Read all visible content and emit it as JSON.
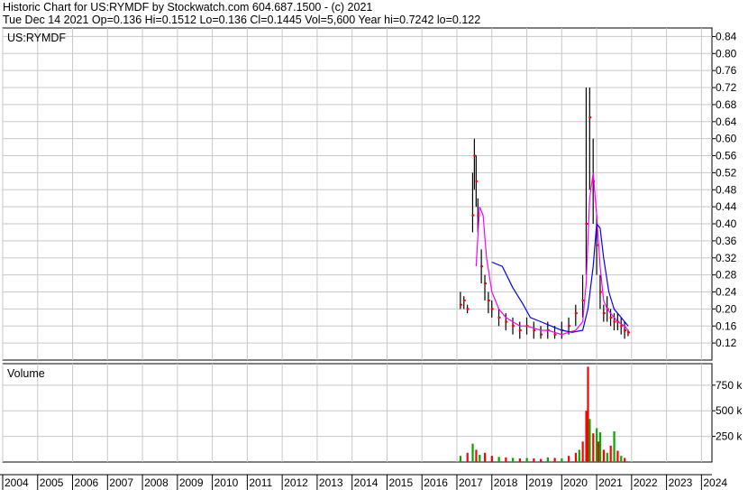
{
  "header": {
    "line1": "Historic Chart for US:RYMDF by Stockwatch.com 604.687.1500 - (c) 2021",
    "line2": "Tue Dec 14 2021   Op=0.136   Hi=0.1512   Lo=0.136   Cl=0.1445   Vol=5,600   Year hi=0.7242   lo=0.122"
  },
  "colors": {
    "price": "#000000",
    "close_marker": "#ff0000",
    "ma_short": "#ff00ff",
    "ma_long": "#0000ff",
    "volume_up": "#00aa00",
    "volume_down": "#ff0000",
    "grid": "#c8c8c8"
  },
  "chart_data": [
    {
      "type": "line",
      "title": "US:RYMDF",
      "xlabel": "",
      "ylabel": "",
      "ylim": [
        0.08,
        0.86
      ],
      "x_range": [
        2004,
        2024.3
      ],
      "grid": true,
      "y_ticks": [
        0.12,
        0.16,
        0.2,
        0.24,
        0.28,
        0.32,
        0.36,
        0.4,
        0.44,
        0.48,
        0.52,
        0.56,
        0.6,
        0.64,
        0.68,
        0.72,
        0.76,
        0.8,
        0.84
      ],
      "y_tick_labels": [
        "0.12",
        "0.16",
        "0.20",
        "0.24",
        "0.28",
        "0.32",
        "0.36",
        "0.40",
        "0.44",
        "0.48",
        "0.52",
        "0.56",
        "0.60",
        "0.64",
        "0.68",
        "0.72",
        "0.76",
        "0.80",
        "0.84"
      ],
      "series": [
        {
          "key": "price",
          "x": [
            2017.1,
            2017.2,
            2017.3,
            2017.45,
            2017.5,
            2017.55,
            2017.6,
            2017.7,
            2017.8,
            2017.9,
            2018.0,
            2018.2,
            2018.4,
            2018.6,
            2018.8,
            2019.0,
            2019.2,
            2019.4,
            2019.6,
            2019.8,
            2020.0,
            2020.2,
            2020.4,
            2020.6,
            2020.7,
            2020.8,
            2020.9,
            2021.0,
            2021.1,
            2021.2,
            2021.3,
            2021.4,
            2021.5,
            2021.6,
            2021.7,
            2021.8,
            2021.9
          ],
          "y": [
            0.21,
            0.22,
            0.2,
            0.42,
            0.56,
            0.5,
            0.42,
            0.3,
            0.26,
            0.22,
            0.2,
            0.18,
            0.17,
            0.16,
            0.15,
            0.16,
            0.15,
            0.14,
            0.15,
            0.14,
            0.15,
            0.16,
            0.19,
            0.22,
            0.4,
            0.65,
            0.5,
            0.35,
            0.24,
            0.19,
            0.2,
            0.18,
            0.17,
            0.17,
            0.16,
            0.15,
            0.145
          ],
          "hi": [
            0.24,
            0.23,
            0.21,
            0.52,
            0.6,
            0.56,
            0.46,
            0.34,
            0.28,
            0.24,
            0.22,
            0.2,
            0.19,
            0.18,
            0.17,
            0.18,
            0.17,
            0.16,
            0.17,
            0.16,
            0.17,
            0.18,
            0.21,
            0.28,
            0.72,
            0.72,
            0.6,
            0.42,
            0.28,
            0.21,
            0.23,
            0.2,
            0.19,
            0.19,
            0.18,
            0.17,
            0.1512
          ],
          "lo": [
            0.2,
            0.2,
            0.19,
            0.38,
            0.48,
            0.44,
            0.38,
            0.26,
            0.22,
            0.19,
            0.18,
            0.16,
            0.15,
            0.14,
            0.13,
            0.14,
            0.13,
            0.13,
            0.13,
            0.13,
            0.13,
            0.14,
            0.16,
            0.18,
            0.28,
            0.48,
            0.4,
            0.28,
            0.2,
            0.17,
            0.17,
            0.16,
            0.15,
            0.15,
            0.14,
            0.13,
            0.136
          ]
        },
        {
          "key": "ma_short",
          "x": [
            2017.55,
            2017.65,
            2017.75,
            2017.85,
            2018.0,
            2018.2,
            2018.4,
            2018.6,
            2018.8,
            2019.0,
            2019.2,
            2019.4,
            2019.6,
            2019.8,
            2020.0,
            2020.2,
            2020.4,
            2020.6,
            2020.7,
            2020.8,
            2020.9,
            2021.0,
            2021.1,
            2021.2,
            2021.3,
            2021.4,
            2021.5,
            2021.6,
            2021.7,
            2021.8,
            2021.9
          ],
          "y": [
            0.3,
            0.44,
            0.42,
            0.32,
            0.24,
            0.2,
            0.18,
            0.17,
            0.16,
            0.16,
            0.155,
            0.15,
            0.15,
            0.145,
            0.14,
            0.145,
            0.15,
            0.17,
            0.26,
            0.46,
            0.52,
            0.42,
            0.3,
            0.22,
            0.2,
            0.19,
            0.18,
            0.17,
            0.165,
            0.16,
            0.15
          ]
        },
        {
          "key": "ma_long",
          "x": [
            2018.0,
            2018.3,
            2018.6,
            2018.9,
            2019.1,
            2019.4,
            2019.7,
            2020.0,
            2020.3,
            2020.6,
            2020.75,
            2020.9,
            2021.0,
            2021.1,
            2021.2,
            2021.35,
            2021.5,
            2021.7,
            2021.9
          ],
          "y": [
            0.31,
            0.3,
            0.25,
            0.21,
            0.18,
            0.17,
            0.16,
            0.15,
            0.145,
            0.15,
            0.2,
            0.3,
            0.4,
            0.39,
            0.32,
            0.24,
            0.2,
            0.18,
            0.16
          ]
        }
      ]
    },
    {
      "type": "bar",
      "title": "Volume",
      "ylim": [
        0,
        960000
      ],
      "x_range": [
        2004,
        2024.3
      ],
      "y_ticks": [
        250000,
        500000,
        750000
      ],
      "y_tick_labels": [
        "250 k",
        "500 k",
        "750 k"
      ],
      "x": [
        2017.1,
        2017.3,
        2017.45,
        2017.55,
        2017.65,
        2017.8,
        2018.0,
        2018.2,
        2018.4,
        2018.6,
        2018.8,
        2019.0,
        2019.2,
        2019.4,
        2019.6,
        2019.8,
        2020.0,
        2020.2,
        2020.4,
        2020.5,
        2020.6,
        2020.7,
        2020.75,
        2020.8,
        2020.9,
        2021.0,
        2021.05,
        2021.1,
        2021.2,
        2021.3,
        2021.4,
        2021.5,
        2021.6,
        2021.7,
        2021.8
      ],
      "values": [
        60000,
        90000,
        180000,
        120000,
        70000,
        90000,
        60000,
        50000,
        45000,
        40000,
        35000,
        40000,
        35000,
        30000,
        45000,
        40000,
        35000,
        60000,
        90000,
        120000,
        200000,
        500000,
        930000,
        420000,
        280000,
        330000,
        200000,
        290000,
        120000,
        90000,
        160000,
        300000,
        110000,
        60000,
        40000
      ],
      "up": [
        true,
        false,
        true,
        false,
        true,
        false,
        false,
        true,
        false,
        true,
        false,
        true,
        false,
        false,
        true,
        false,
        true,
        false,
        false,
        true,
        false,
        false,
        false,
        true,
        false,
        true,
        false,
        true,
        false,
        true,
        false,
        true,
        false,
        true,
        false
      ]
    }
  ],
  "x_axis": {
    "labels": [
      "2004",
      "2005",
      "2006",
      "2007",
      "2008",
      "2009",
      "2010",
      "2011",
      "2012",
      "2013",
      "2014",
      "2015",
      "2016",
      "2017",
      "2018",
      "2019",
      "2020",
      "2021",
      "2022",
      "2023",
      "2024"
    ]
  }
}
